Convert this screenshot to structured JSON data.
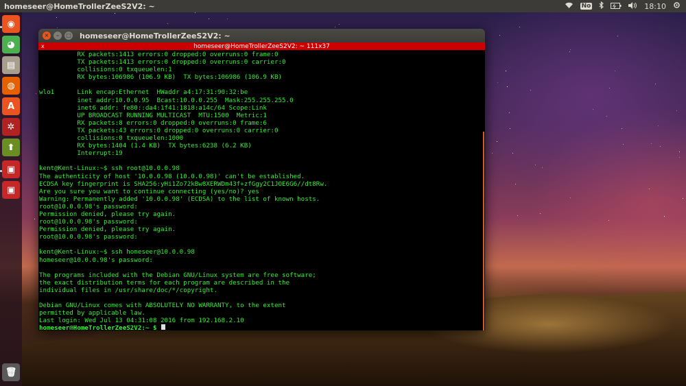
{
  "top_panel": {
    "title": "homeseer@HomeTrollerZeeS2V2: ~",
    "keyboard_badge": "No",
    "time": "18:10"
  },
  "launcher": {
    "items": [
      {
        "name": "ubuntu-dash-icon",
        "glyph": "◉",
        "color": "#e95420"
      },
      {
        "name": "chrome-icon",
        "glyph": "◕",
        "color": "#4caf50"
      },
      {
        "name": "files-icon",
        "glyph": "▤",
        "color": "#a89e8e"
      },
      {
        "name": "firefox-icon",
        "glyph": "◍",
        "color": "#e66000"
      },
      {
        "name": "software-center-icon",
        "glyph": "A",
        "color": "#e95420"
      },
      {
        "name": "system-settings-icon",
        "glyph": "✲",
        "color": "#b22222"
      },
      {
        "name": "software-updater-icon",
        "glyph": "⬆",
        "color": "#6b8e23"
      },
      {
        "name": "terminal-icon",
        "glyph": "▣",
        "color": "#c62828"
      },
      {
        "name": "terminal-icon-2",
        "glyph": "▣",
        "color": "#c62828"
      },
      {
        "name": "trash-icon",
        "glyph": "🗑",
        "color": "#5a5a5a"
      }
    ]
  },
  "window": {
    "title": "homeseer@HomeTrollerZeeS2V2: ~",
    "tab_title": "homeseer@HomeTrollerZeeS2V2: ~ 111x37",
    "tab_close": "x"
  },
  "terminal": {
    "lines": [
      "          RX packets:1413 errors:0 dropped:0 overruns:0 frame:0",
      "          TX packets:1413 errors:0 dropped:0 overruns:0 carrier:0",
      "          collisions:0 txqueuelen:1",
      "          RX bytes:106986 (106.9 KB)  TX bytes:106986 (106.9 KB)",
      "",
      "wlo1      Link encap:Ethernet  HWaddr a4:17:31:90:32:be",
      "          inet addr:10.0.0.95  Bcast:10.0.0.255  Mask:255.255.255.0",
      "          inet6 addr: fe80::da4:1f41:1818:a14c/64 Scope:Link",
      "          UP BROADCAST RUNNING MULTICAST  MTU:1500  Metric:1",
      "          RX packets:8 errors:0 dropped:0 overruns:0 frame:6",
      "          TX packets:43 errors:0 dropped:0 overruns:0 carrier:0",
      "          collisions:0 txqueuelen:1000",
      "          RX bytes:1404 (1.4 KB)  TX bytes:6238 (6.2 KB)",
      "          Interrupt:19",
      "",
      "kent@Kent-Linux:~$ ssh root@10.0.0.98",
      "The authenticity of host '10.0.0.98 (10.0.0.98)' can't be established.",
      "ECDSA key fingerprint is SHA256:yHi1Zo72kBw8XERWDm43f+zfGgy2C1JOE6G6//dt8Rw.",
      "Are you sure you want to continue connecting (yes/no)? yes",
      "Warning: Permanently added '10.0.0.98' (ECDSA) to the list of known hosts.",
      "root@10.0.0.98's password:",
      "Permission denied, please try again.",
      "root@10.0.0.98's password:",
      "Permission denied, please try again.",
      "root@10.0.0.98's password:",
      "",
      "kent@Kent-Linux:~$ ssh homeseer@10.0.0.98",
      "homeseer@10.0.0.98's password:",
      "",
      "The programs included with the Debian GNU/Linux system are free software;",
      "the exact distribution terms for each program are described in the",
      "individual files in /usr/share/doc/*/copyright.",
      "",
      "Debian GNU/Linux comes with ABSOLUTELY NO WARRANTY, to the extent",
      "permitted by applicable law.",
      "Last login: Wed Jul 13 04:31:08 2016 from 192.168.2.10"
    ],
    "prompt": "homeseer@HomeTrollerZeeS2V2:~ $ "
  }
}
